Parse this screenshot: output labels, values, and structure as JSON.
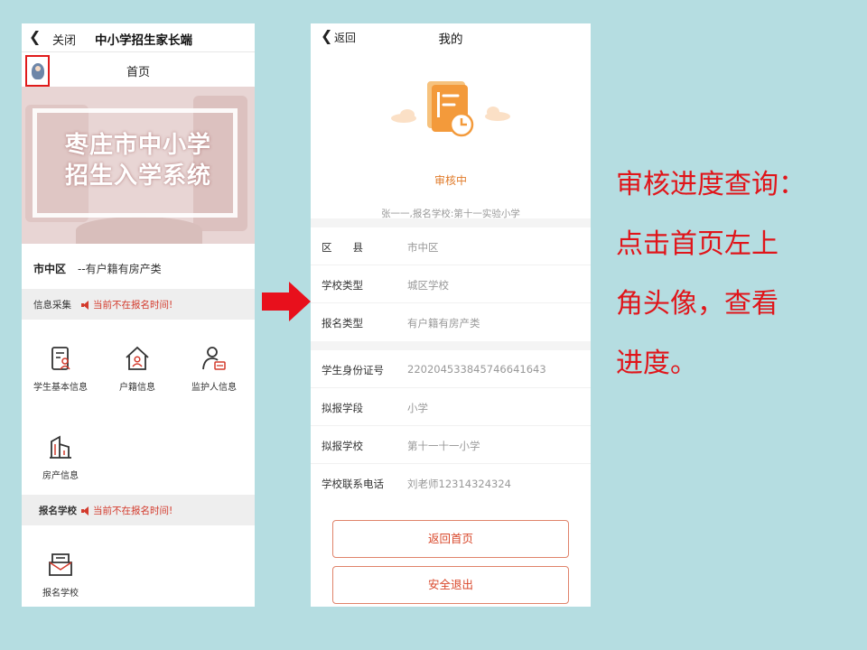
{
  "left_phone": {
    "topbar": {
      "back_icon": "chevron-left-icon",
      "close_label": "关闭",
      "title": "中小学招生家长端"
    },
    "header": {
      "title": "首页",
      "avatar_icon": "user-avatar-icon"
    },
    "banner": {
      "line1": "枣庄市中小学",
      "line2": "招生入学系统"
    },
    "district": {
      "name": "市中区",
      "type": "--有户籍有房产类"
    },
    "section_info": {
      "title": "信息采集",
      "warning": "当前不在报名时间!"
    },
    "info_items": [
      {
        "label": "学生基本信息",
        "icon": "student-info-icon"
      },
      {
        "label": "户籍信息",
        "icon": "household-icon"
      },
      {
        "label": "监护人信息",
        "icon": "guardian-icon"
      },
      {
        "label": "房产信息",
        "icon": "property-icon"
      }
    ],
    "section_register": {
      "title": "报名学校",
      "warning": "当前不在报名时间!"
    },
    "register_items": [
      {
        "label": "报名学校",
        "icon": "school-register-icon"
      }
    ]
  },
  "right_phone": {
    "topbar": {
      "back_icon": "chevron-left-icon",
      "back_label": "返回",
      "title": "我的"
    },
    "status": {
      "icon": "pending-review-icon",
      "label": "审核中",
      "info": "张一一,报名学校:第十一实验小学"
    },
    "group1": [
      {
        "key": "区　　县",
        "value": "市中区"
      },
      {
        "key": "学校类型",
        "value": "城区学校"
      },
      {
        "key": "报名类型",
        "value": "有户籍有房产类"
      }
    ],
    "group2": [
      {
        "key": "学生身份证号",
        "value": "220204533845746641643"
      },
      {
        "key": "拟报学段",
        "value": "小学"
      },
      {
        "key": "拟报学校",
        "value": "第十一十一小学"
      },
      {
        "key": "学校联系电话",
        "value": "刘老师12314324324"
      }
    ],
    "buttons": {
      "home": "返回首页",
      "logout": "安全退出"
    }
  },
  "instructions": {
    "line1": "审核进度查询：",
    "line2": "点击首页左上",
    "line3": "角头像，查看",
    "line4": "进度。"
  },
  "colors": {
    "background": "#b5dde1",
    "accent_red": "#e0151a",
    "status_orange": "#e07b2a",
    "button_border": "#e0836a"
  }
}
